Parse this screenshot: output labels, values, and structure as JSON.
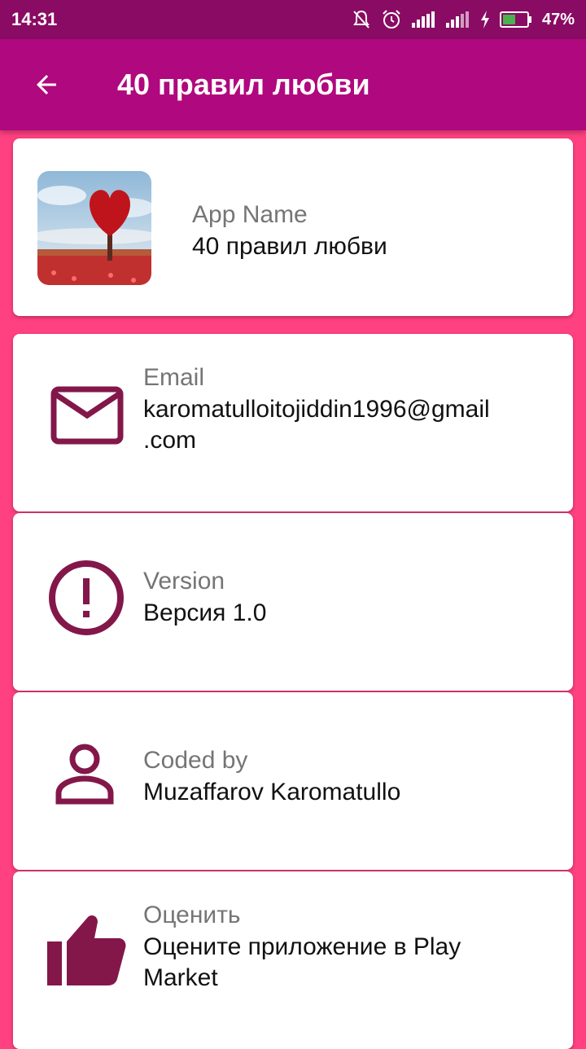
{
  "status_bar": {
    "time": "14:31",
    "battery": "47%"
  },
  "app_bar": {
    "title": "40 правил любви"
  },
  "cards": [
    {
      "label": "App Name",
      "value": "40 правил любви",
      "icon": "app-thumbnail-image"
    },
    {
      "label": "Email",
      "value": "karomatulloitojiddin1996@gmail",
      "value_line2": ".com",
      "icon": "mail-icon"
    },
    {
      "label": "Version",
      "value": "Версия 1.0",
      "icon": "info-alert-icon"
    },
    {
      "label": "Coded by",
      "value": "Muzaffarov Karomatullo",
      "icon": "person-icon"
    },
    {
      "label": "Оценить",
      "value": "Оцените приложение в Play",
      "value_line2": "Market",
      "icon": "thumb-up-icon"
    }
  ],
  "colors": {
    "status": "#8a0b63",
    "app_bar": "#b0087e",
    "background": "#ff4081",
    "icon": "#83174a"
  }
}
